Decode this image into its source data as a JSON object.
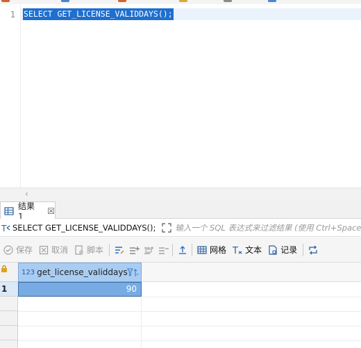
{
  "editor": {
    "line_number": "1",
    "code": "SELECT GET_LICENSE_VALIDDAYS();"
  },
  "results": {
    "tab_label": "结果 1",
    "tab_close": "☒",
    "filter": {
      "query": "SELECT GET_LICENSE_VALIDDAYS();",
      "placeholder": "输入一个 SQL 表达式来过滤结果 (使用 Ctrl+Space)"
    },
    "toolbar": {
      "save": "保存",
      "cancel": "取消",
      "script": "脚本",
      "grid": "网格",
      "text": "文本",
      "record": "记录"
    },
    "grid": {
      "column_type": "123",
      "column_name": "get_license_validdays",
      "row_number": "1",
      "value": "90"
    }
  },
  "colors": {
    "selection": "#1f6fce",
    "column_header": "#a9cdf2",
    "selected_cell": "#78abe3"
  }
}
